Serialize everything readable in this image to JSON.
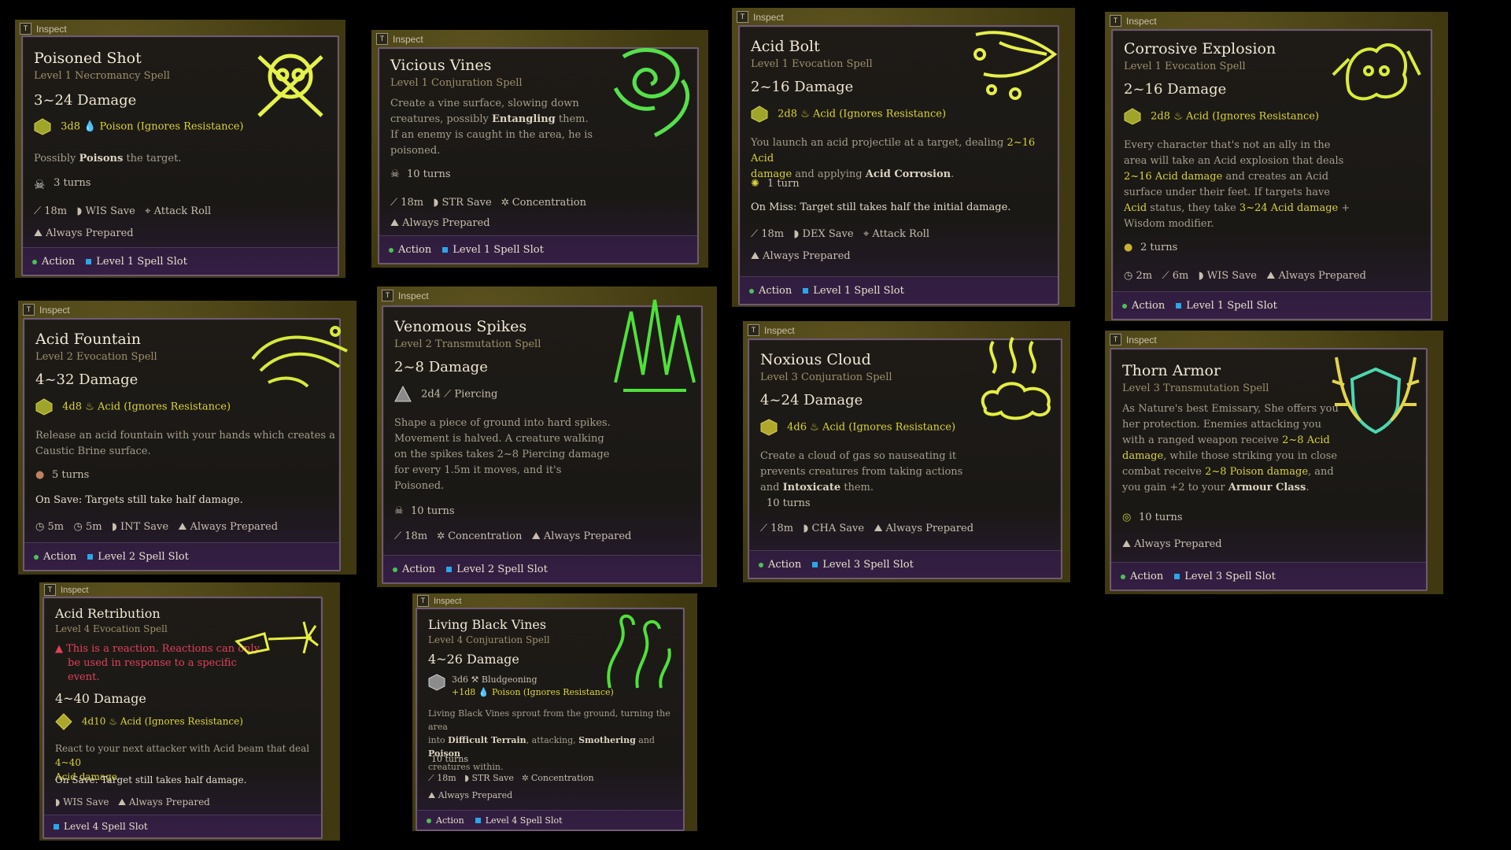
{
  "inspect_label": "Inspect",
  "inspect_key": "T",
  "footer": {
    "action": "Action",
    "slot1": "Level 1 Spell Slot",
    "slot2": "Level 2 Spell Slot",
    "slot3": "Level 3 Spell Slot",
    "slot4": "Level 4 Spell Slot"
  },
  "common": {
    "always_prepared": "Always Prepared",
    "attack_roll": "Attack Roll",
    "concentration": "Concentration"
  },
  "cards": {
    "poisoned_shot": {
      "name": "Poisoned Shot",
      "level": "Level 1 Necromancy Spell",
      "damage": "3~24 Damage",
      "dice": "3d8",
      "dtype": "Poison (Ignores Resistance)",
      "desc_pre": "Possibly ",
      "desc_b": "Poisons",
      "desc_post": " the target.",
      "turns": "3 turns",
      "range": "18m",
      "save": "WIS Save",
      "attack": "Attack Roll"
    },
    "vicious_vines": {
      "name": "Vicious Vines",
      "level": "Level 1 Conjuration Spell",
      "d1": "Create a vine surface, slowing down",
      "d2a": "creatures, possibly ",
      "d2b": "Entangling",
      "d2c": " them.",
      "d3": "If an enemy is caught in the area, he is",
      "d4": "poisoned.",
      "turns": "10 turns",
      "range": "18m",
      "save": "STR Save",
      "conc": "Concentration"
    },
    "acid_bolt": {
      "name": "Acid Bolt",
      "level": "Level 1 Evocation Spell",
      "damage": "2~16 Damage",
      "dice": "2d8",
      "dtype": "Acid (Ignores Resistance)",
      "d1a": "You launch an acid projectile at a target, dealing ",
      "d1b": "2~16 Acid",
      "d2a": "damage",
      "d2b": " and applying ",
      "d2c": "Acid Corrosion",
      "d2d": ".",
      "turns": "1 turn",
      "miss": "On Miss: Target still takes half the initial damage.",
      "range": "18m",
      "save": "DEX Save",
      "attack": "Attack Roll"
    },
    "corrosive_explosion": {
      "name": "Corrosive Explosion",
      "level": "Level 1 Evocation Spell",
      "damage": "2~16 Damage",
      "dice": "2d8",
      "dtype": "Acid (Ignores Resistance)",
      "d1": "Every character that's not an ally in the",
      "d2": "area will take an Acid explosion that deals",
      "d3a": "2~16 Acid damage",
      "d3b": " and creates an Acid",
      "d4": "surface under their feet. If targets have",
      "d5a": "Acid",
      "d5b": " status, they take ",
      "d5c": "3~24 Acid damage",
      "d5d": " +",
      "d6": "Wisdom modifier.",
      "turns": "2 turns",
      "radius": "2m",
      "range": "6m",
      "save": "WIS Save"
    },
    "acid_fountain": {
      "name": "Acid Fountain",
      "level": "Level 2 Evocation Spell",
      "damage": "4~32 Damage",
      "dice": "4d8",
      "dtype": "Acid (Ignores Resistance)",
      "d1": "Release an acid fountain with your hands which creates a",
      "d2": "Caustic Brine surface.",
      "turns": "5 turns",
      "save_note": "On Save: Targets still take half damage.",
      "r1": "5m",
      "r2": "5m",
      "save": "INT Save"
    },
    "venomous_spikes": {
      "name": "Venomous Spikes",
      "level": "Level 2 Transmutation Spell",
      "damage": "2~8 Damage",
      "dice": "2d4",
      "dtype": "Piercing",
      "d1": "Shape a piece of ground into hard spikes.",
      "d2": "Movement is halved. A creature walking",
      "d3": "on the spikes takes 2~8 Piercing damage",
      "d4": "for every 1.5m it moves, and it's",
      "d5": "Poisoned.",
      "turns": "10 turns",
      "range": "18m",
      "conc": "Concentration"
    },
    "noxious_cloud": {
      "name": "Noxious Cloud",
      "level": "Level 3 Conjuration Spell",
      "damage": "4~24 Damage",
      "dice": "4d6",
      "dtype": "Acid (Ignores Resistance)",
      "d1": "Create a cloud of gas so nauseating it",
      "d2": "prevents creatures from taking actions",
      "d3a": "and ",
      "d3b": "Intoxicate",
      "d3c": " them.",
      "turns": "10 turns",
      "range": "18m",
      "save": "CHA Save"
    },
    "thorn_armor": {
      "name": "Thorn Armor",
      "level": "Level 3 Transmutation Spell",
      "d1": "As Nature's best Emissary, She offers you",
      "d2": "her protection. Enemies attacking you",
      "d3a": "with a ranged weapon receive ",
      "d3b": "2~8 Acid",
      "d4a": "damage",
      "d4b": ", while those striking you in close",
      "d5a": "combat receive ",
      "d5b": "2~8 Poison damage",
      "d5c": ", and",
      "d6a": "you gain +2 to your ",
      "d6b": "Armour Class",
      "d6c": ".",
      "turns": "10 turns"
    },
    "acid_retribution": {
      "name": "Acid Retribution",
      "level": "Level 4 Evocation Spell",
      "w1": "This is a reaction. Reactions can only",
      "w2": "be used in response to a specific",
      "w3": "event.",
      "damage": "4~40 Damage",
      "dice": "4d10",
      "dtype": "Acid (Ignores Resistance)",
      "d1a": "React to your next attacker with Acid beam that deal ",
      "d1b": "4~40",
      "d2": "Acid damage",
      "d2b": ".",
      "save_note": "On Save: Target still takes half damage.",
      "save": "WIS Save"
    },
    "living_black_vines": {
      "name": "Living Black Vines",
      "level": "Level 4 Conjuration Spell",
      "damage": "4~26 Damage",
      "dice1": "3d6",
      "dtype1": "Bludgeoning",
      "dice2": "+1d8",
      "dtype2": "Poison (Ignores Resistance)",
      "d1": "Living Black Vines sprout from the ground, turning the area",
      "d2a": "into ",
      "d2b": "Difficult Terrain",
      "d2c": ", attacking, ",
      "d2d": "Smothering",
      "d2e": " and ",
      "d2f": "Poison",
      "d3": "creatures within.",
      "turns": "10 turns",
      "range": "18m",
      "save": "STR Save",
      "conc": "Concentration"
    }
  }
}
